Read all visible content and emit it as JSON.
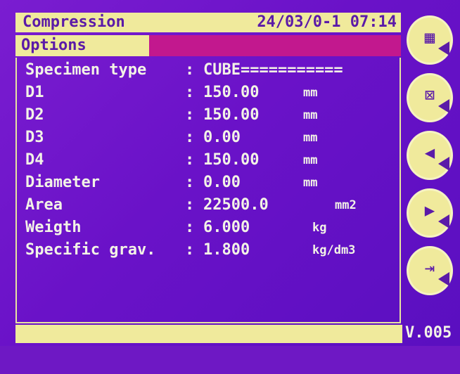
{
  "header": {
    "title": "Compression",
    "datetime": "24/03/0-1 07:14"
  },
  "tab": {
    "label": "Options"
  },
  "fields": [
    {
      "label": "Specimen type",
      "sep": ":",
      "value": "CUBE===========",
      "unit": ""
    },
    {
      "label": "D1",
      "sep": ":",
      "value": "150.00",
      "unit": "mm"
    },
    {
      "label": "D2",
      "sep": ":",
      "value": "150.00",
      "unit": "mm"
    },
    {
      "label": "D3",
      "sep": ":",
      "value": "0.00",
      "unit": "mm"
    },
    {
      "label": "D4",
      "sep": ":",
      "value": "150.00",
      "unit": "mm"
    },
    {
      "label": "Diameter",
      "sep": ":",
      "value": "0.00",
      "unit": "mm"
    },
    {
      "label": "Area",
      "sep": ":",
      "value": "22500.0",
      "unit": "mm2"
    },
    {
      "label": "Weigth",
      "sep": ":",
      "value": "6.000",
      "unit": "kg"
    },
    {
      "label": "Specific grav.",
      "sep": ":",
      "value": "1.800",
      "unit": "kg/dm3"
    }
  ],
  "sidebar": {
    "buttons": [
      {
        "name": "table-icon",
        "glyph": "▦"
      },
      {
        "name": "delete-table-icon",
        "glyph": "⊠"
      },
      {
        "name": "arrow-left-icon",
        "glyph": "◀"
      },
      {
        "name": "arrow-right-icon",
        "glyph": "▶"
      },
      {
        "name": "exit-door-icon",
        "glyph": "⇥"
      }
    ]
  },
  "footer": {
    "version": "V.005"
  },
  "colors": {
    "background": "#6a12c8",
    "highlight": "#f0ea9c",
    "text": "#f3f3e6",
    "tab_bar": "#c2188e"
  }
}
